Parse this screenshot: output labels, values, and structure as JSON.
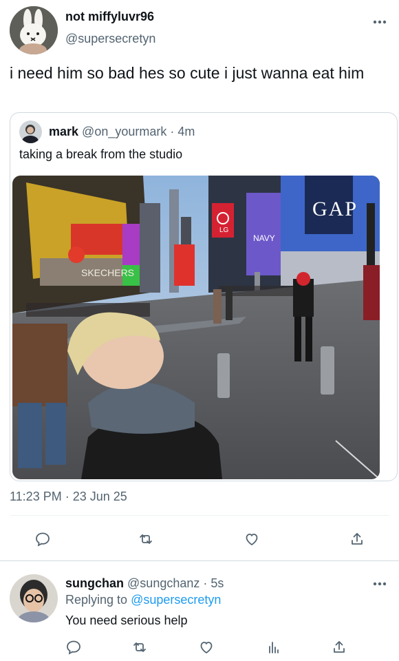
{
  "main_tweet": {
    "display_name": "not miffyluvr96",
    "handle": "@supersecretyn",
    "text": "i need him so bad hes so cute i just wanna eat him",
    "timestamp": "11:23 PM · 23 Jun 25"
  },
  "quoted_tweet": {
    "display_name": "mark",
    "handle": "@on_yourmark",
    "time": "· 4m",
    "text": "taking a break from the studio",
    "photo_signs": {
      "gap": "GAP",
      "lg": "LG",
      "navy": "NAVY",
      "sketchers": "SKECHERS"
    }
  },
  "reply": {
    "display_name": "sungchan",
    "handle": "@sungchanz",
    "time": "· 5s",
    "replying_prefix": "Replying to",
    "replying_to": "@supersecretyn",
    "text": "You need serious help"
  },
  "icons": {
    "more": "more-icon",
    "reply": "reply-icon",
    "retweet": "retweet-icon",
    "like": "like-icon",
    "share": "share-icon",
    "views": "views-icon"
  },
  "colors": {
    "link": "#1d9bf0",
    "secondary_text": "#536471",
    "icon": "#536471",
    "border": "#cfd9de"
  }
}
